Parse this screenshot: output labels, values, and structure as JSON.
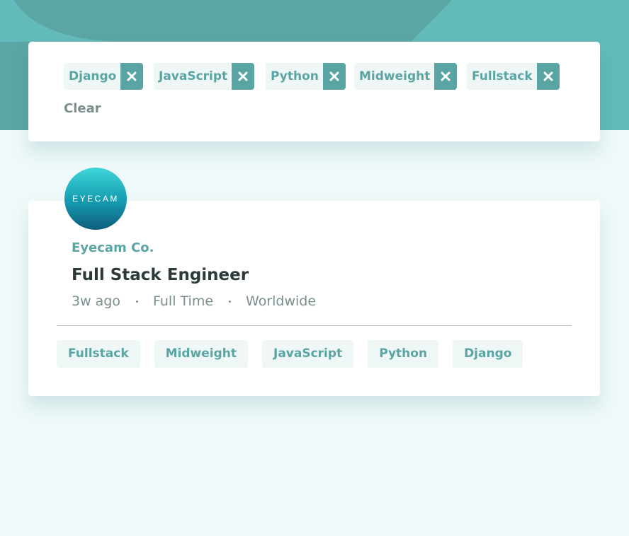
{
  "filter_bar": {
    "filters": [
      {
        "label": "Django"
      },
      {
        "label": "JavaScript"
      },
      {
        "label": "Python"
      },
      {
        "label": "Midweight"
      },
      {
        "label": "Fullstack"
      }
    ],
    "clear_label": "Clear"
  },
  "job": {
    "logo_text": "EYECAM",
    "company": "Eyecam Co.",
    "position": "Full Stack Engineer",
    "posted": "3w ago",
    "contract": "Full Time",
    "location": "Worldwide",
    "tags": [
      "Fullstack",
      "Midweight",
      "JavaScript",
      "Python",
      "Django"
    ]
  },
  "colors": {
    "header_bg": "#63baba",
    "page_bg": "#eff9f9",
    "accent": "#5ba4a4",
    "tag_bg": "#eef6f6",
    "text_dark": "#2c3a3a",
    "text_gray": "#7b8e8e"
  },
  "icons": {
    "remove": "close-icon"
  }
}
